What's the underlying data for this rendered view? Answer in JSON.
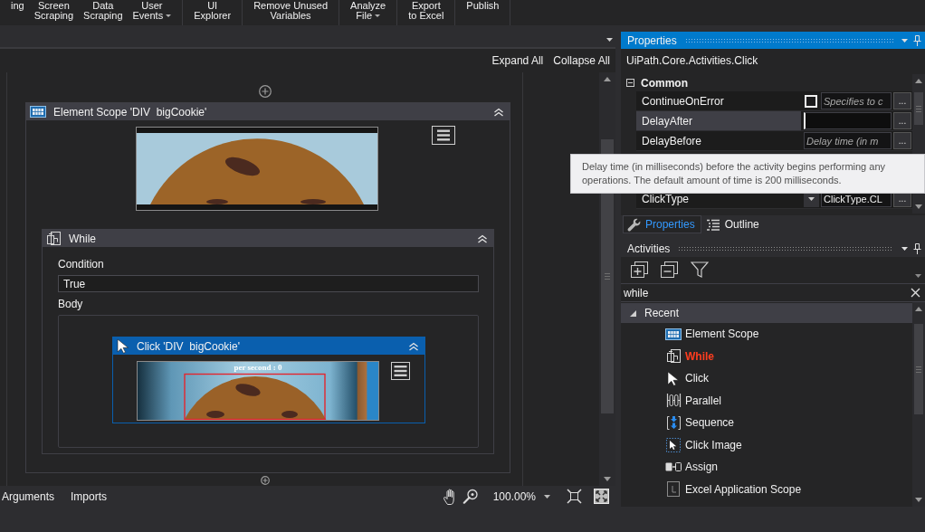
{
  "toolbar": {
    "groups": [
      {
        "buttons": [
          {
            "label": "ing",
            "dropdown": false
          },
          {
            "label": "Screen\nScraping",
            "dropdown": false
          },
          {
            "label": "Data\nScraping",
            "dropdown": false
          },
          {
            "label": "User\nEvents",
            "dropdown": true
          }
        ]
      },
      {
        "buttons": [
          {
            "label": "UI\nExplorer",
            "dropdown": false
          }
        ]
      },
      {
        "buttons": [
          {
            "label": "Remove Unused\nVariables",
            "dropdown": false
          }
        ]
      },
      {
        "buttons": [
          {
            "label": "Analyze\nFile",
            "dropdown": true
          }
        ]
      },
      {
        "buttons": [
          {
            "label": "Export\nto Excel",
            "dropdown": false
          }
        ]
      },
      {
        "buttons": [
          {
            "label": "Publish",
            "dropdown": false
          }
        ]
      }
    ]
  },
  "designer": {
    "expand_all": "Expand All",
    "collapse_all": "Collapse All",
    "element_scope": {
      "title": "Element Scope 'DIV  bigCookie'",
      "selected": false,
      "expanded": true,
      "while": {
        "title": "While",
        "selected": false,
        "expanded": true,
        "condition_label": "Condition",
        "condition": "True",
        "body_label": "Body",
        "click": {
          "title": "Click 'DIV  bigCookie'",
          "selected": true,
          "expanded": true,
          "image_caption": "per second : 0"
        }
      }
    }
  },
  "status_bar": {
    "tabs": [
      {
        "label": "Arguments",
        "selected": false
      },
      {
        "label": "Imports",
        "selected": false
      }
    ],
    "zoom": "100.00%"
  },
  "properties": {
    "title": "Properties",
    "focused": true,
    "type_name": "UiPath.Core.Activities.Click",
    "category": {
      "name": "Common",
      "expanded": true
    },
    "rows": [
      {
        "name": "ContinueOnError",
        "kind": "checkbox",
        "checked": false,
        "placeholder": "Specifies to c",
        "selected": false,
        "button": "..."
      },
      {
        "name": "DelayAfter",
        "kind": "text",
        "selected": true,
        "button": "..."
      },
      {
        "name": "DelayBefore",
        "kind": "text",
        "placeholder": "Delay time (in m",
        "selected": false,
        "button": "..."
      },
      {
        "name": "ClickType",
        "kind": "dropdown",
        "value": "ClickType.CL",
        "selected": false,
        "button": "..."
      }
    ],
    "tabs": [
      {
        "label": "Properties",
        "selected": true
      },
      {
        "label": "Outline",
        "selected": false
      }
    ]
  },
  "tooltip": {
    "text": "Delay time (in milliseconds) before the activity begins performing any operations. The default amount of time is 200 milliseconds."
  },
  "activities": {
    "title": "Activities",
    "focused": false,
    "search": {
      "value": "while"
    },
    "tree": [
      {
        "label": "Recent",
        "expanded": true,
        "children": [
          {
            "label": "Element Scope",
            "highlighted": false
          },
          {
            "label": "While",
            "highlighted": true
          },
          {
            "label": "Click",
            "highlighted": false
          },
          {
            "label": "Parallel",
            "highlighted": false
          },
          {
            "label": "Sequence",
            "highlighted": false
          },
          {
            "label": "Click Image",
            "highlighted": false
          },
          {
            "label": "Assign",
            "highlighted": false
          },
          {
            "label": "Excel Application Scope",
            "highlighted": false
          }
        ]
      }
    ]
  }
}
